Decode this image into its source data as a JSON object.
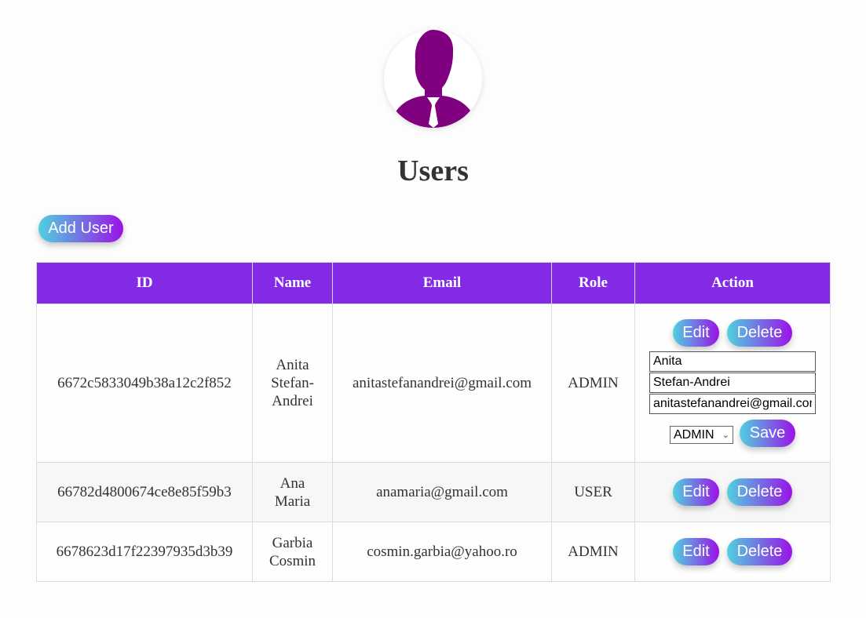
{
  "page": {
    "title": "Users",
    "add_user_label": "Add User"
  },
  "table": {
    "headers": [
      "ID",
      "Name",
      "Email",
      "Role",
      "Action"
    ],
    "rows": [
      {
        "id": "6672c5833049b38a12c2f852",
        "name_line1": "Anita",
        "name_line2": "Stefan-",
        "name_line3": "Andrei",
        "email": "anitastefanandrei@gmail.com",
        "role": "ADMIN"
      },
      {
        "id": "66782d4800674ce8e85f59b3",
        "name_line1": "Ana",
        "name_line2": "Maria",
        "email": "anamaria@gmail.com",
        "role": "USER"
      },
      {
        "id": "6678623d17f22397935d3b39",
        "name_line1": "Garbia",
        "name_line2": "Cosmin",
        "email": "cosmin.garbia@yahoo.ro",
        "role": "ADMIN"
      }
    ]
  },
  "actions": {
    "edit_label": "Edit",
    "delete_label": "Delete",
    "save_label": "Save"
  },
  "edit_form": {
    "first_name": "Anita",
    "last_name": "Stefan-Andrei",
    "email": "anitastefanandrei@gmail.com",
    "role_selected": "ADMIN"
  },
  "icons": {
    "avatar": "user-avatar-icon",
    "select_arrow": "chevron-down-icon"
  },
  "colors": {
    "header_bg": "#832ae6",
    "button_gradient_start": "#4fd1e0",
    "button_gradient_end": "#9a12e6",
    "avatar_fill": "#800080"
  }
}
